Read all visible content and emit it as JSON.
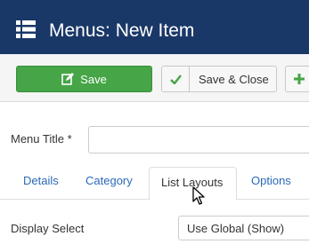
{
  "header": {
    "title": "Menus: New Item",
    "icon": "list-icon",
    "background": "#1a3867"
  },
  "toolbar": {
    "save_label": "Save",
    "save_close_label": "Save & Close",
    "save_icon": "edit-icon",
    "save_close_icon": "check-icon",
    "new_icon": "plus-icon",
    "save_color": "#46a546"
  },
  "form": {
    "menu_title_label": "Menu Title *",
    "menu_title_value": "",
    "display_select_label": "Display Select",
    "display_select_value": "Use Global (Show)"
  },
  "tabs": [
    {
      "label": "Details",
      "active": false
    },
    {
      "label": "Category",
      "active": false
    },
    {
      "label": "List Layouts",
      "active": true
    },
    {
      "label": "Options",
      "active": false
    }
  ]
}
